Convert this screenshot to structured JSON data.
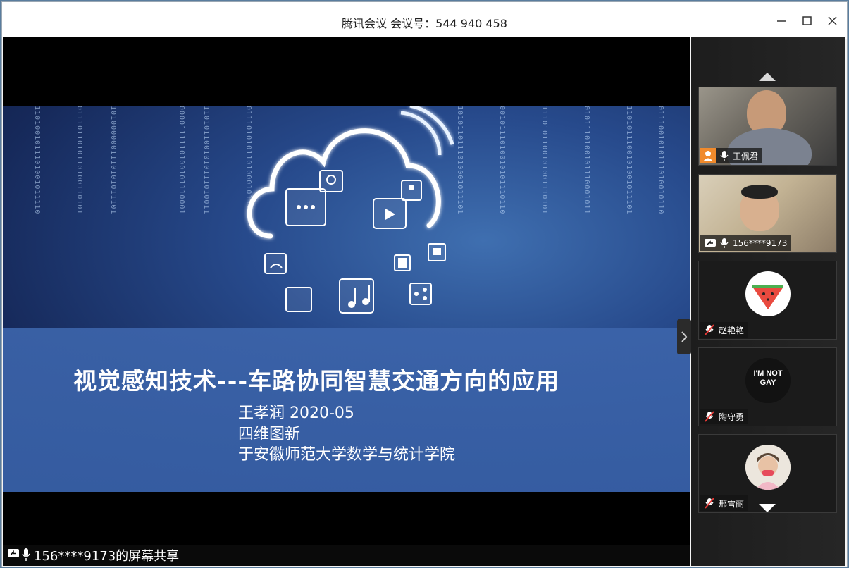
{
  "window": {
    "title": "腾讯会议 会议号：544 940 458",
    "controls": [
      "minimize-icon",
      "maximize-icon",
      "close-icon"
    ]
  },
  "slide": {
    "title": "视觉感知技术---车路协同智慧交通方向的应用",
    "author_line": "王孝润    2020-05",
    "org_line": "四维图新",
    "venue_line": "于安徽师范大学数学与统计学院"
  },
  "share_status": {
    "text": "156****9173的屏幕共享",
    "icons": [
      "screen-share-icon",
      "microphone-icon"
    ]
  },
  "participants": [
    {
      "name": "王佩君",
      "video": true,
      "mic": "on",
      "badge": "host-icon"
    },
    {
      "name": "156****9173",
      "video": true,
      "mic": "on",
      "badge": "screen-share-icon"
    },
    {
      "name": "赵艳艳",
      "video": false,
      "mic": "muted",
      "avatar": "watermelon"
    },
    {
      "name": "陶守勇",
      "video": false,
      "mic": "muted",
      "avatar": "text-logo",
      "avatar_text": "I'M NOT GAY"
    },
    {
      "name": "邢雪丽",
      "video": false,
      "mic": "muted",
      "avatar": "photo"
    }
  ],
  "colors": {
    "host_badge": "#f08a2c",
    "banner": "#3c64aa",
    "panel": "#222222"
  }
}
